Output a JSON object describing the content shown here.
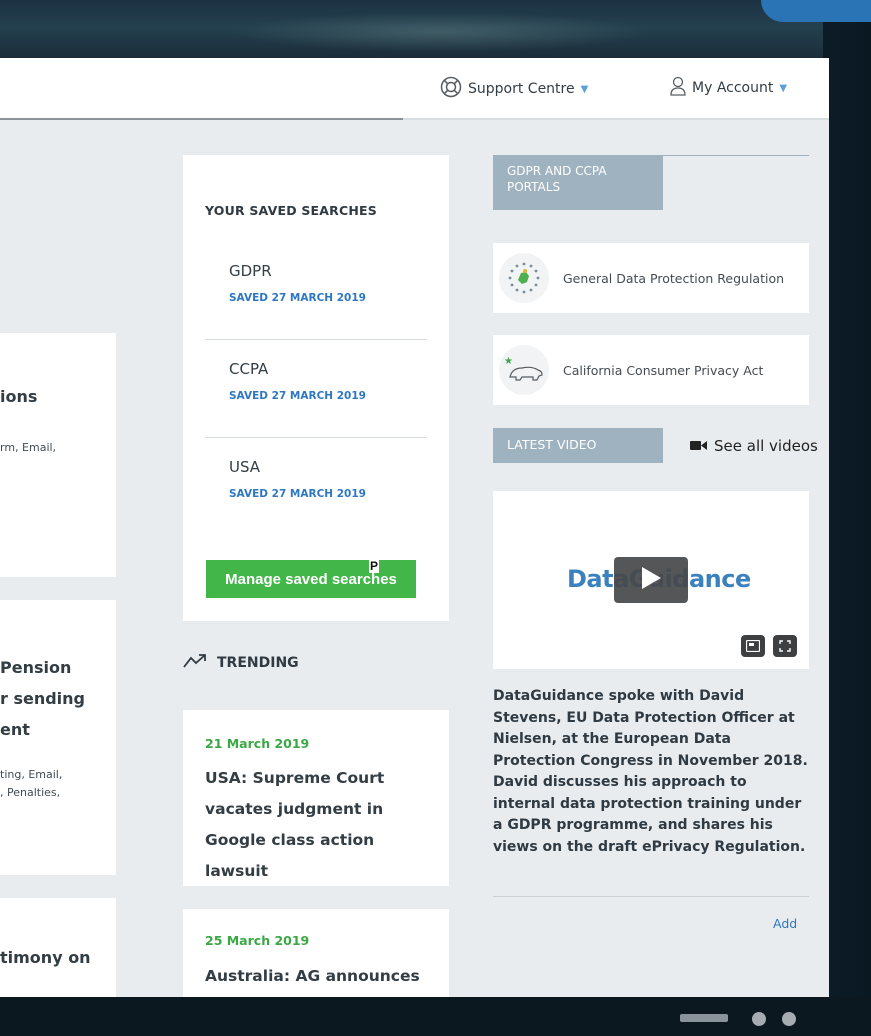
{
  "topbar": {
    "support_label": "Support Centre",
    "account_label": "My Account"
  },
  "left_cards": [
    {
      "title": "ions",
      "tags": [
        "rm, Email,"
      ]
    },
    {
      "title_lines": [
        "Pension",
        "r sending",
        "ent"
      ],
      "tags": [
        "ting, Email,",
        ", Penalties,"
      ]
    },
    {
      "title": "timony on"
    }
  ],
  "saved_searches": {
    "heading": "YOUR SAVED SEARCHES",
    "items": [
      {
        "name": "GDPR",
        "date": "SAVED 27 MARCH 2019"
      },
      {
        "name": "CCPA",
        "date": "SAVED 27 MARCH 2019"
      },
      {
        "name": "USA",
        "date": "SAVED 27 MARCH 2019"
      }
    ],
    "manage_label": "Manage saved searches",
    "cursor_char": "P"
  },
  "trending": {
    "heading": "TRENDING",
    "items": [
      {
        "date": "21 March 2019",
        "title": "USA: Supreme Court vacates judgment in Google class action lawsuit"
      },
      {
        "date": "25 March 2019",
        "title": "Australia: AG announces"
      }
    ]
  },
  "portals": {
    "heading": "GDPR AND CCPA PORTALS",
    "items": [
      {
        "label": "General Data Protection Regulation",
        "icon": "eu-flag-icon"
      },
      {
        "label": "California Consumer Privacy Act",
        "icon": "california-bear-icon"
      }
    ]
  },
  "video": {
    "heading": "LATEST VIDEO",
    "see_all_label": "See all videos",
    "brand": "DataGuidance",
    "description": "DataGuidance spoke with David Stevens, EU Data Protection Officer at Nielsen, at the European Data Protection Congress in November 2018. David discusses his approach to internal data protection training under a GDPR programme, and shares his views on the draft ePrivacy Regulation.",
    "add_label": "Add"
  },
  "colors": {
    "accent_green": "#43b649",
    "date_blue": "#2e78c2",
    "header_blue_grey": "#9fb2c0",
    "screen_bg": "#e9ecee"
  }
}
